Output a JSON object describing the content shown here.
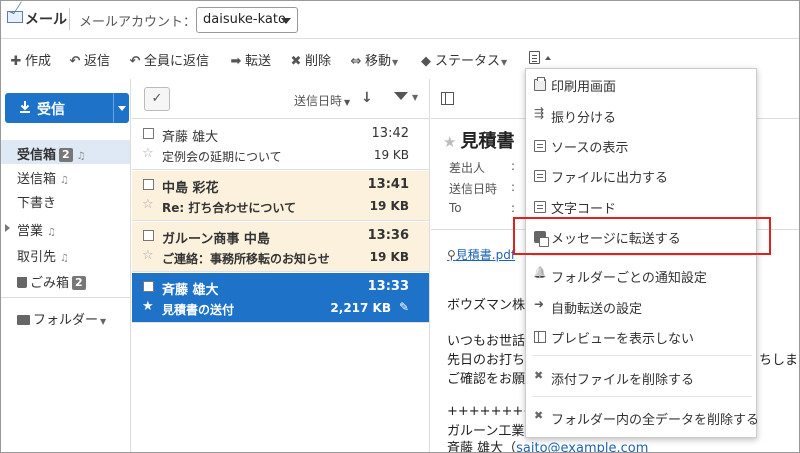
{
  "header": {
    "app_title": "メール",
    "account_label": "メールアカウント：",
    "account_value": "daisuke-kato"
  },
  "toolbar": {
    "compose": "作成",
    "reply": "返信",
    "reply_all": "全員に返信",
    "forward": "転送",
    "delete": "削除",
    "move": "移動",
    "status": "ステータス"
  },
  "sidebar": {
    "receive_button": "受信",
    "folders": [
      {
        "name": "受信箱",
        "badge": "2"
      },
      {
        "name": "送信箱"
      },
      {
        "name": "下書き"
      },
      {
        "name": "営業"
      },
      {
        "name": "取引先"
      },
      {
        "name": "ごみ箱",
        "badge": "2"
      }
    ],
    "folder_menu": "フォルダー"
  },
  "message_list": {
    "sort_label": "送信日時",
    "messages": [
      {
        "sender": "斉藤 雄大",
        "time": "13:42",
        "subject": "定例会の延期について",
        "size": "19 KB"
      },
      {
        "sender": "中島 彩花",
        "time": "13:41",
        "subject": "Re: 打ち合わせについて",
        "size": "19 KB"
      },
      {
        "sender": "ガルーン商事 中島",
        "time": "13:36",
        "subject": "ご連絡：事務所移転のお知らせ",
        "size": "19 KB"
      },
      {
        "sender": "斉藤 雄大",
        "time": "13:33",
        "subject": "見積書の送付",
        "size": "2,217 KB"
      }
    ]
  },
  "preview": {
    "title": "見積書",
    "from_label": "差出人",
    "sent_label": "送信日時",
    "to_label": "To",
    "attachment": "見積書.pdf",
    "body": [
      "ボウズマン株",
      "いつもお世話",
      "先日のお打ち",
      "ご確認をお願",
      "++++++++",
      "ガルーン工業",
      "斉藤 雄大（"
    ],
    "body_right_fragment": "ちしまし",
    "email": "saito@example.com"
  },
  "more_menu": {
    "items": [
      "印刷用画面",
      "振り分ける",
      "ソースの表示",
      "ファイルに出力する",
      "文字コード",
      "メッセージに転送する",
      "フォルダーごとの通知設定",
      "自動転送の設定",
      "プレビューを表示しない",
      "添付ファイルを削除する",
      "フォルダー内の全データを削除する"
    ]
  },
  "colors": {
    "accent": "#1e73c9",
    "unread_bg": "#fbf1dc",
    "highlight": "#e0221c"
  }
}
